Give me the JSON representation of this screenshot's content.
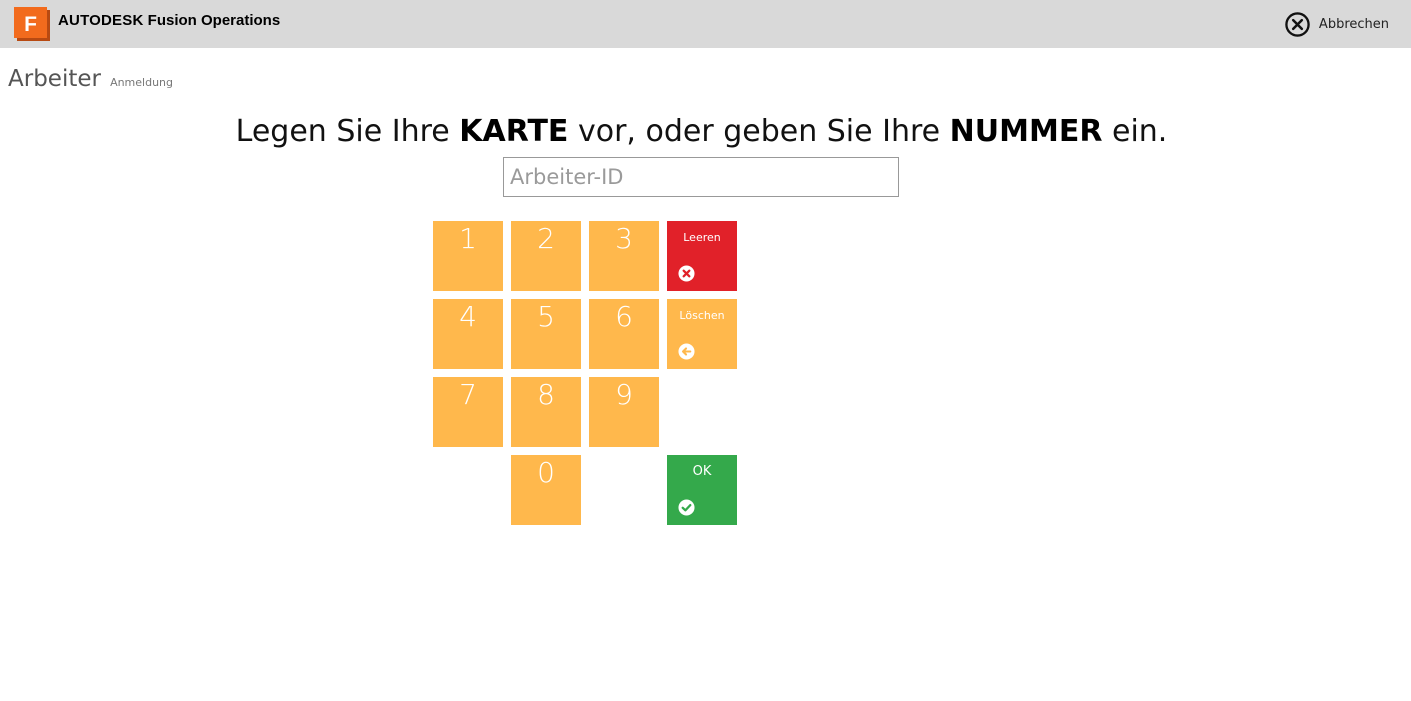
{
  "header": {
    "brand_bold": "AUTODESK",
    "brand_name": "Fusion Operations",
    "logo_letter": "F",
    "logo_color": "#f26b1d",
    "cancel_label": "Abbrechen",
    "cancel_icon": "close-circle-icon"
  },
  "page": {
    "title": "Arbeiter",
    "subtitle": "Anmeldung"
  },
  "instruction": {
    "part1": "Legen Sie Ihre ",
    "bold1": "KARTE",
    "part2": " vor, oder geben Sie Ihre ",
    "bold2": "NUMMER",
    "part3": " ein."
  },
  "input": {
    "placeholder": "Arbeiter-ID",
    "value": ""
  },
  "keypad": {
    "digits": [
      "1",
      "2",
      "3",
      "4",
      "5",
      "6",
      "7",
      "8",
      "9",
      "0"
    ],
    "key_color": "#ffb84c",
    "clear": {
      "label": "Leeren",
      "icon": "x-circle-icon",
      "color": "#e12129"
    },
    "delete": {
      "label": "Löschen",
      "icon": "arrow-left-circle-icon",
      "color": "#ffb84c"
    },
    "ok": {
      "label": "OK",
      "icon": "check-circle-icon",
      "color": "#34a94b"
    }
  }
}
